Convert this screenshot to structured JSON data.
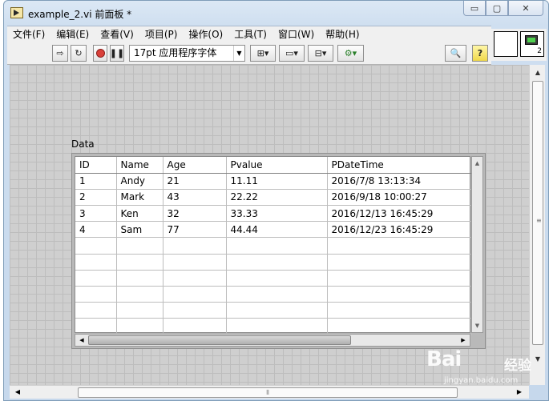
{
  "window": {
    "title": "example_2.vi 前面板 *",
    "controls": {
      "minimize": "▭",
      "maximize": "▢",
      "close": "✕"
    }
  },
  "menu": {
    "items": [
      "文件(F)",
      "编辑(E)",
      "查看(V)",
      "项目(P)",
      "操作(O)",
      "工具(T)",
      "窗口(W)",
      "帮助(H)"
    ]
  },
  "toolbar": {
    "font_select": "17pt 应用程序字体",
    "icons": [
      "run-arrow-icon",
      "run-continuously-icon",
      "abort-icon",
      "pause-icon",
      "align-objects-icon",
      "distribute-objects-icon",
      "resize-objects-icon",
      "reorder-icon",
      "search-icon",
      "help-icon"
    ]
  },
  "connector": {
    "terminal_count": "2"
  },
  "table": {
    "label": "Data",
    "columns": [
      "ID",
      "Name",
      "Age",
      "Pvalue",
      "PDateTime"
    ],
    "rows": [
      [
        "1",
        "Andy",
        "21",
        "11.11",
        "2016/7/8 13:13:34"
      ],
      [
        "2",
        "Mark",
        "43",
        "22.22",
        "2016/9/18 10:00:27"
      ],
      [
        "3",
        "Ken",
        "32",
        "33.33",
        "2016/12/13 16:45:29"
      ],
      [
        "4",
        "Sam",
        "77",
        "44.44",
        "2016/12/23 16:45:29"
      ]
    ]
  },
  "watermark": {
    "logo": "Bai",
    "brand": "经验",
    "url": "jingyan.baidu.com"
  }
}
